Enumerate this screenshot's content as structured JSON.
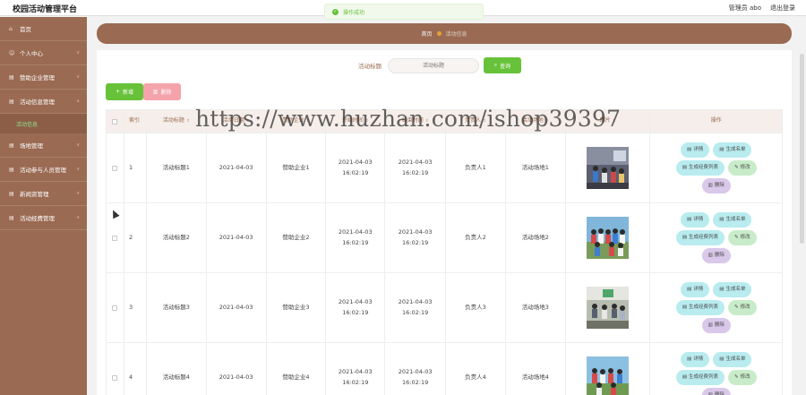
{
  "app": {
    "title": "校园活动管理平台"
  },
  "header": {
    "user_label": "管理员 abo",
    "logout_label": "退出登录"
  },
  "toast": {
    "message": "操作成功",
    "icon": "check-circle-icon"
  },
  "sidebar": {
    "items": [
      {
        "label": "首页",
        "icon": "home-icon"
      },
      {
        "label": "个人中心",
        "icon": "user-icon"
      },
      {
        "label": "赞助企业管理",
        "icon": "building-icon"
      },
      {
        "label": "活动信息管理",
        "icon": "list-icon"
      },
      {
        "label": "场地管理",
        "icon": "place-icon"
      },
      {
        "label": "活动参与人员管理",
        "icon": "people-icon"
      },
      {
        "label": "新闻资管理",
        "icon": "news-icon"
      },
      {
        "label": "活动经费管理",
        "icon": "money-icon"
      }
    ],
    "sub_item": {
      "label": "活动信息"
    }
  },
  "breadcrumb": {
    "home": "首页",
    "current": "活动信息"
  },
  "search": {
    "label": "活动标题",
    "placeholder": "活动标题",
    "button_label": "查询"
  },
  "toolbar": {
    "add_label": "新增",
    "delete_label": "删除"
  },
  "table": {
    "headers": {
      "index": "索引",
      "title": "活动标题",
      "date": "活动日期",
      "sponsor": "赞助企业",
      "start": "开始时间",
      "end": "结束时间",
      "manager": "负责人",
      "place": "活动场地",
      "image": "图片",
      "ops": "操作"
    },
    "rows": [
      {
        "index": "1",
        "title": "活动标题1",
        "date": "2021-04-03",
        "sponsor": "赞助企业1",
        "start": "2021-04-03 16:02:19",
        "end": "2021-04-03 16:02:19",
        "manager": "负责人1",
        "place": "活动场地1"
      },
      {
        "index": "2",
        "title": "活动标题2",
        "date": "2021-04-03",
        "sponsor": "赞助企业2",
        "start": "2021-04-03 16:02:19",
        "end": "2021-04-03 16:02:19",
        "manager": "负责人2",
        "place": "活动场地2"
      },
      {
        "index": "3",
        "title": "活动标题3",
        "date": "2021-04-03",
        "sponsor": "赞助企业3",
        "start": "2021-04-03 16:02:19",
        "end": "2021-04-03 16:02:19",
        "manager": "负责人3",
        "place": "活动场地3"
      },
      {
        "index": "4",
        "title": "活动标题4",
        "date": "2021-04-03",
        "sponsor": "赞助企业4",
        "start": "2021-04-03 16:02:19",
        "end": "2021-04-03 16:02:19",
        "manager": "负责人4",
        "place": "活动场地4"
      }
    ],
    "actions": {
      "detail": "详情",
      "gen_list": "生成名单",
      "gen_fee": "生成经费列表",
      "edit": "修改",
      "delete": "删除"
    }
  },
  "watermark": {
    "text": "https://www.huzhan.com/ishop39397"
  },
  "colors": {
    "sidebar": "#9a6a52",
    "primary_green": "#67c23a",
    "danger_pink": "#f5a3ab",
    "action_cyan": "#b8ecef",
    "action_green": "#c8ecc9",
    "action_purple": "#d9c8ea"
  }
}
